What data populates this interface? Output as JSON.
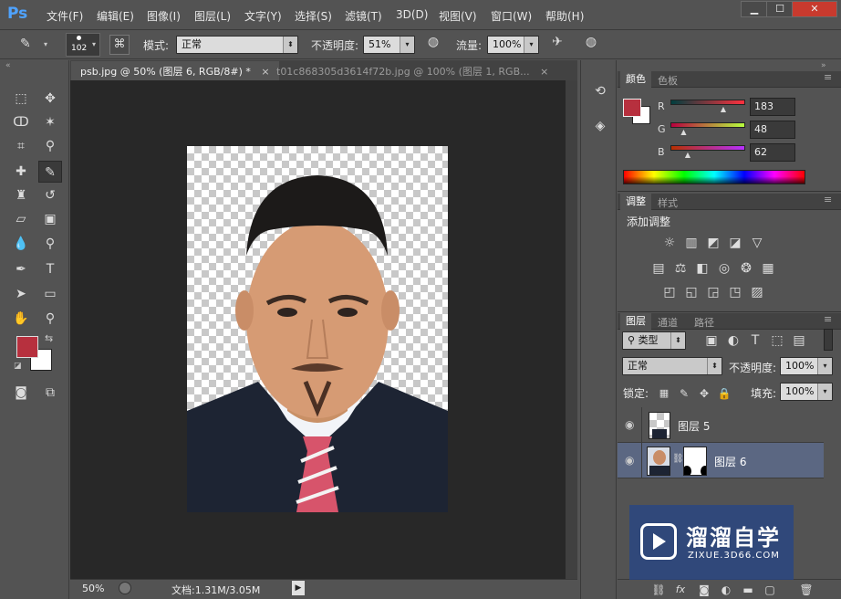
{
  "app": {
    "logo": "Ps"
  },
  "menus": [
    "文件(F)",
    "编辑(E)",
    "图像(I)",
    "图层(L)",
    "文字(Y)",
    "选择(S)",
    "滤镜(T)",
    "3D(D)",
    "视图(V)",
    "窗口(W)",
    "帮助(H)"
  ],
  "window_controls": {
    "minimize": "▁",
    "maximize": "☐",
    "close": "✕"
  },
  "options": {
    "brush_size": "102",
    "mode_label": "模式:",
    "mode_value": "正常",
    "opacity_label": "不透明度:",
    "opacity_value": "51%",
    "flow_label": "流量:",
    "flow_value": "100%"
  },
  "tabs": [
    {
      "label": "psb.jpg @ 50% (图层 6, RGB/8#) *",
      "close": "×",
      "active": true
    },
    {
      "label": "t01c868305d3614f72b.jpg @ 100% (图层 1, RGB...",
      "close": "×",
      "active": false
    }
  ],
  "status": {
    "zoom": "50%",
    "doc": "文档:1.31M/3.05M"
  },
  "color_panel": {
    "tabs": [
      "颜色",
      "色板"
    ],
    "r_label": "R",
    "r": "183",
    "g_label": "G",
    "g": "48",
    "b_label": "B",
    "b": "62",
    "r_fraction": 0.718,
    "g_fraction": 0.188,
    "b_fraction": 0.243,
    "foreground": "#b7303e"
  },
  "adjust_panel": {
    "tabs": [
      "调整",
      "样式"
    ],
    "title": "添加调整"
  },
  "layers_panel": {
    "tabs": [
      "图层",
      "通道",
      "路径"
    ],
    "filter_label": "类型",
    "blend_mode": "正常",
    "opacity_label": "不透明度:",
    "opacity": "100%",
    "lock_label": "锁定:",
    "fill_label": "填充:",
    "fill": "100%",
    "layers": [
      {
        "name": "图层 5",
        "selected": false
      },
      {
        "name": "图层 6",
        "selected": true
      }
    ]
  },
  "watermark": {
    "title": "溜溜自学",
    "url": "ZIXUE.3D66.COM"
  }
}
